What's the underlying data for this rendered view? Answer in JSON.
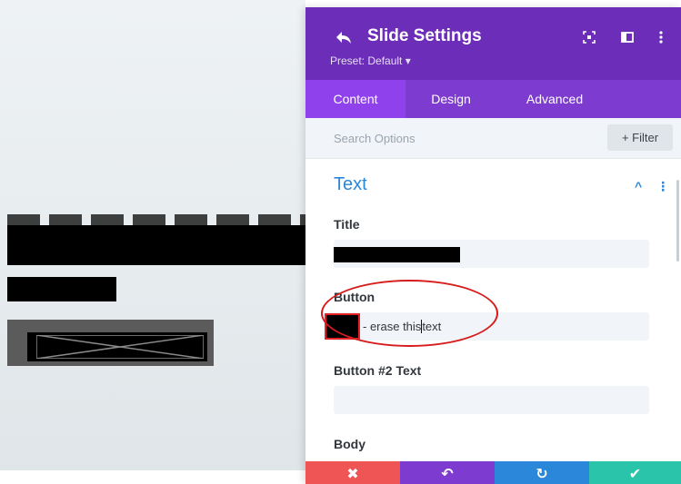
{
  "panel": {
    "title": "Slide Settings",
    "preset": "Preset: Default ▾",
    "header_icons": [
      "back-icon",
      "responsive-icon",
      "split-view-icon",
      "more-icon"
    ]
  },
  "tabs": [
    {
      "label": "Content",
      "active": true
    },
    {
      "label": "Design",
      "active": false
    },
    {
      "label": "Advanced",
      "active": false
    }
  ],
  "search": {
    "placeholder": "Search Options",
    "filter_label": "+ Filter"
  },
  "section": {
    "title": "Text",
    "collapse_icon": "^",
    "menu_icon": "⋮"
  },
  "fields": {
    "title_label": "Title",
    "button_label": "Button",
    "button_value_before": "- erase this",
    "button_value_after": "text",
    "button2_label": "Button #2 Text",
    "body_label": "Body"
  },
  "actions": [
    {
      "name": "discard",
      "symbol": "✖",
      "color": "#ef5555"
    },
    {
      "name": "undo",
      "symbol": "↶",
      "color": "#7e3bd0"
    },
    {
      "name": "redo",
      "symbol": "↻",
      "color": "#2b87da"
    },
    {
      "name": "save",
      "symbol": "✔",
      "color": "#29c4a9"
    }
  ],
  "colors": {
    "header": "#6c2eb9",
    "tabs": "#7e3bd0",
    "accent": "#2b87da",
    "annotation": "#d71c1c"
  }
}
